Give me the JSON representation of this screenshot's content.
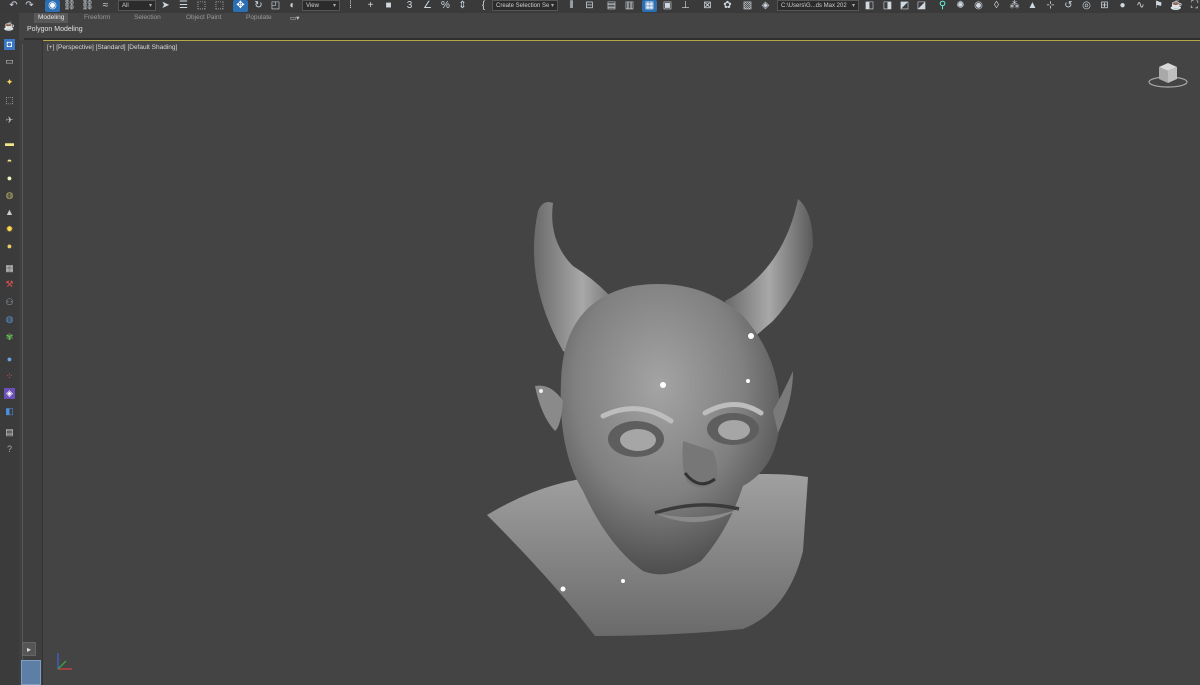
{
  "toolbar": {
    "selection_filter": "All",
    "reference_coord": "View",
    "named_selection": "Create Selection Se",
    "project_path": "C:\\Users\\G...ds Max 202"
  },
  "ribbon": {
    "tabs": [
      "Modeling",
      "Freeform",
      "Selection",
      "Object Paint",
      "Populate"
    ],
    "active_panel": "Polygon Modeling"
  },
  "viewport": {
    "label_view": "[+]",
    "label_camera": "[Perspective]",
    "label_style": "[Standard]",
    "label_shading": "[Default Shading]"
  },
  "colors": {
    "viewport_bg": "#444444",
    "active_border": "#b8a84a",
    "accent": "#2d6fb3"
  },
  "icons": [
    "undo-icon",
    "redo-icon",
    "link-icon",
    "unlink-icon",
    "bind-spacewarp-icon",
    "select-object-icon",
    "select-by-name-icon",
    "rectangular-selection-icon",
    "window-crossing-icon",
    "move-icon",
    "rotate-icon",
    "scale-icon",
    "snaps-icon",
    "angle-snap-icon",
    "percent-snap-icon",
    "spinner-snap-icon",
    "mirror-icon",
    "align-icon",
    "layer-explorer-icon",
    "scene-explorer-icon",
    "curve-editor-icon",
    "schematic-view-icon",
    "material-editor-icon",
    "render-setup-icon",
    "render-frame-icon",
    "render-icon",
    "viewcube-icon",
    "axis-tripod-icon"
  ]
}
